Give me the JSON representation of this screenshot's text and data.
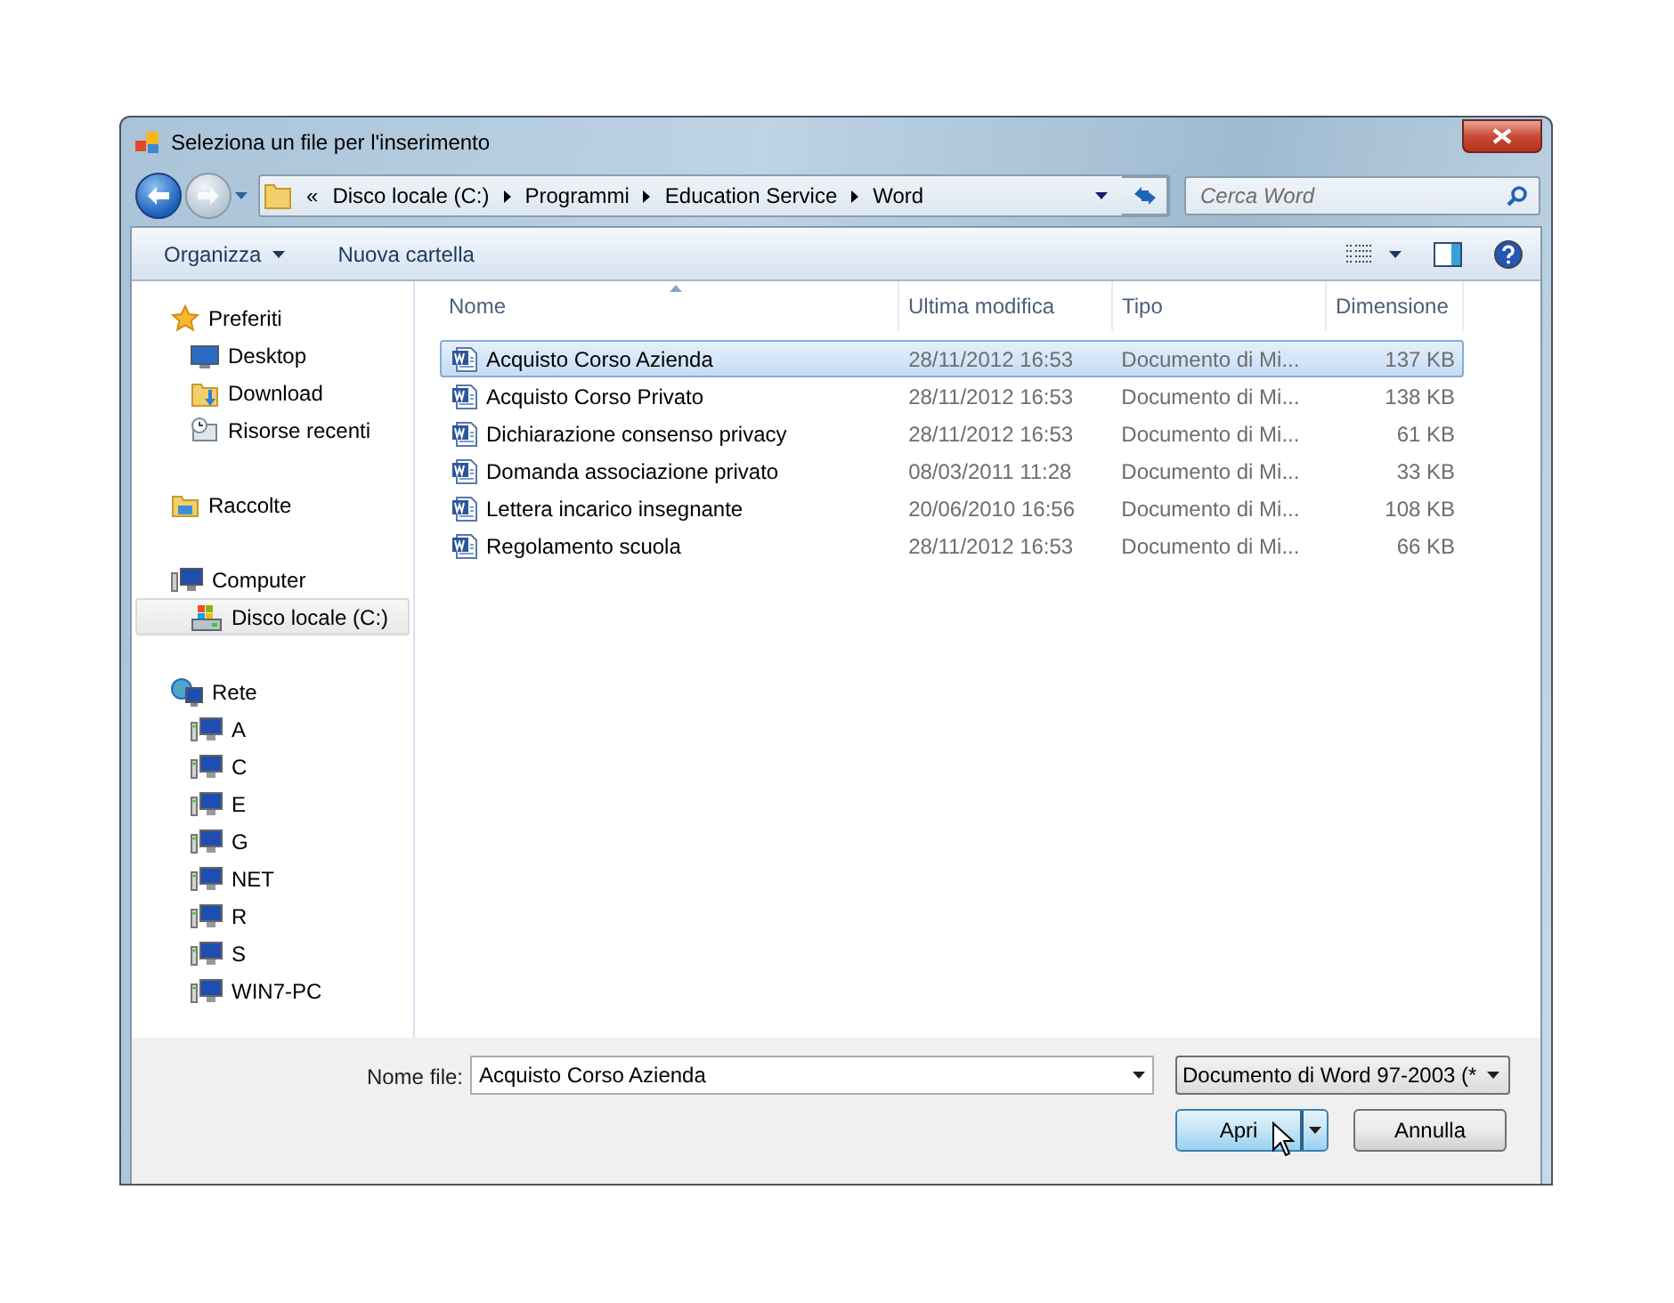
{
  "window": {
    "title": "Seleziona un file per l'inserimento"
  },
  "address_bar": {
    "overflow": "«",
    "crumbs": [
      "Disco locale (C:)",
      "Programmi",
      "Education Service",
      "Word"
    ]
  },
  "search": {
    "placeholder": "Cerca Word"
  },
  "toolbar": {
    "organize": "Organizza",
    "new_folder": "Nuova cartella"
  },
  "sidebar": {
    "groups": [
      {
        "label": "Preferiti",
        "kind": "star",
        "selected": false,
        "children": [
          {
            "label": "Desktop",
            "kind": "desktop",
            "selected": false
          },
          {
            "label": "Download",
            "kind": "download",
            "selected": false
          },
          {
            "label": "Risorse recenti",
            "kind": "recent",
            "selected": false
          }
        ]
      },
      {
        "label": "Raccolte",
        "kind": "library",
        "selected": false
      },
      {
        "label": "Computer",
        "kind": "computer",
        "selected": false,
        "children": [
          {
            "label": "Disco locale (C:)",
            "kind": "drive",
            "selected": true
          }
        ]
      },
      {
        "label": "Rete",
        "kind": "network",
        "selected": false,
        "children": [
          {
            "label": "A",
            "kind": "pc",
            "selected": false
          },
          {
            "label": "C",
            "kind": "pc",
            "selected": false
          },
          {
            "label": "E",
            "kind": "pc",
            "selected": false
          },
          {
            "label": "G",
            "kind": "pc",
            "selected": false
          },
          {
            "label": "NET",
            "kind": "pc",
            "selected": false
          },
          {
            "label": "R",
            "kind": "pc",
            "selected": false
          },
          {
            "label": "S",
            "kind": "pc",
            "selected": false
          },
          {
            "label": "WIN7-PC",
            "kind": "pc",
            "selected": false
          }
        ]
      }
    ]
  },
  "table": {
    "columns": [
      {
        "label": "Nome",
        "sorted": true
      },
      {
        "label": "Ultima modifica",
        "sorted": false
      },
      {
        "label": "Tipo",
        "sorted": false
      },
      {
        "label": "Dimensione",
        "sorted": false
      }
    ],
    "rows": [
      {
        "name": "Acquisto Corso Azienda",
        "modified": "28/11/2012 16:53",
        "type": "Documento di Mi...",
        "size": "137 KB",
        "selected": true
      },
      {
        "name": "Acquisto Corso Privato",
        "modified": "28/11/2012 16:53",
        "type": "Documento di Mi...",
        "size": "138 KB",
        "selected": false
      },
      {
        "name": "Dichiarazione consenso privacy",
        "modified": "28/11/2012 16:53",
        "type": "Documento di Mi...",
        "size": "61 KB",
        "selected": false
      },
      {
        "name": "Domanda associazione privato",
        "modified": "08/03/2011 11:28",
        "type": "Documento di Mi...",
        "size": "33 KB",
        "selected": false
      },
      {
        "name": "Lettera incarico insegnante",
        "modified": "20/06/2010 16:56",
        "type": "Documento di Mi...",
        "size": "108 KB",
        "selected": false
      },
      {
        "name": "Regolamento scuola",
        "modified": "28/11/2012 16:53",
        "type": "Documento di Mi...",
        "size": "66 KB",
        "selected": false
      }
    ]
  },
  "footer": {
    "filename_label": "Nome file:",
    "filename": "Acquisto Corso Azienda",
    "filetype": "Documento di Word 97-2003 (*",
    "open": "Apri",
    "cancel": "Annulla"
  }
}
